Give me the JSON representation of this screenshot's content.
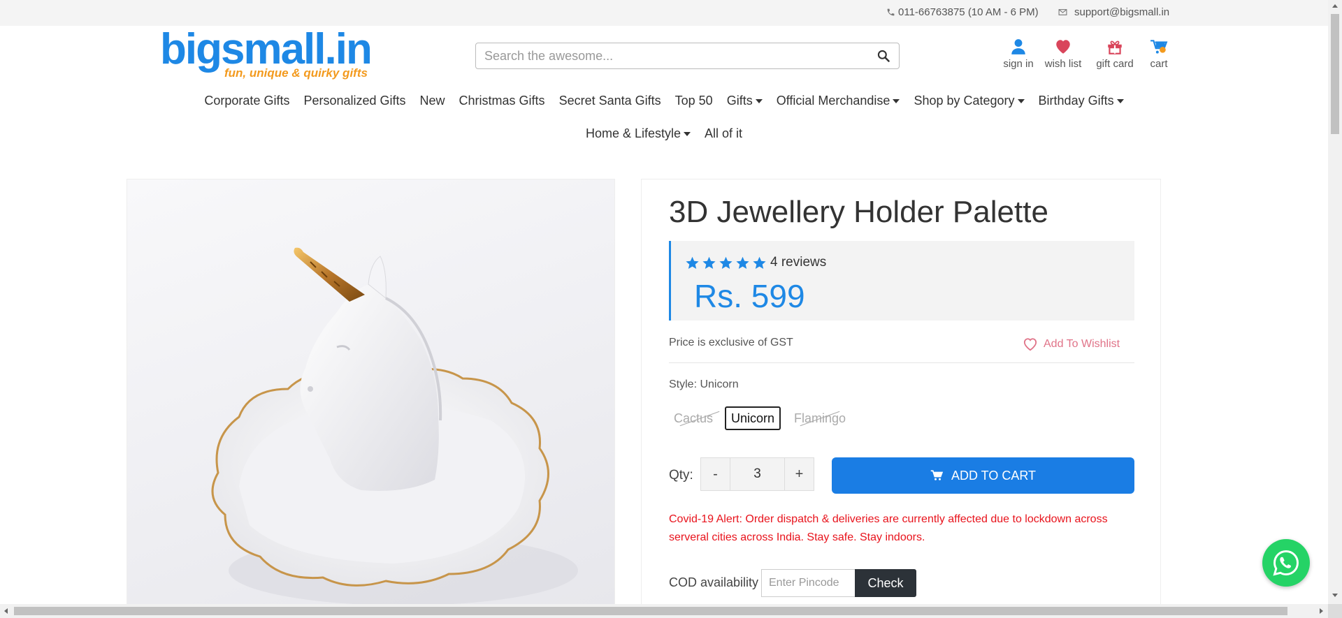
{
  "topbar": {
    "phone": "011-66763875 (10 AM - 6 PM)",
    "email": "support@bigsmall.in"
  },
  "header": {
    "logo_text": "bigsmall.in",
    "logo_tagline": "fun, unique & quirky gifts",
    "search_placeholder": "Search the awesome...",
    "icons": {
      "signin": "sign in",
      "wishlist": "wish list",
      "giftcard": "gift card",
      "cart": "cart"
    }
  },
  "nav": {
    "row1": [
      {
        "label": "Corporate Gifts",
        "dropdown": false
      },
      {
        "label": "Personalized Gifts",
        "dropdown": false
      },
      {
        "label": "New",
        "dropdown": false
      },
      {
        "label": "Christmas Gifts",
        "dropdown": false
      },
      {
        "label": "Secret Santa Gifts",
        "dropdown": false
      },
      {
        "label": "Top 50",
        "dropdown": false
      },
      {
        "label": "Gifts",
        "dropdown": true
      },
      {
        "label": "Official Merchandise",
        "dropdown": true
      },
      {
        "label": "Shop by Category",
        "dropdown": true
      },
      {
        "label": "Birthday Gifts",
        "dropdown": true
      }
    ],
    "row2": [
      {
        "label": "Home & Lifestyle",
        "dropdown": true
      },
      {
        "label": "All of it",
        "dropdown": false
      }
    ]
  },
  "product": {
    "title": "3D Jewellery Holder Palette",
    "rating_stars": 5,
    "reviews": "4 reviews",
    "price": "Rs. 599",
    "gst_note": "Price is exclusive of GST",
    "wishlist_label": "Add To Wishlist",
    "style_label": "Style: Unicorn",
    "styles": [
      {
        "label": "Cactus",
        "available": false
      },
      {
        "label": "Unicorn",
        "available": true,
        "selected": true
      },
      {
        "label": "Flamingo",
        "available": false
      }
    ],
    "qty_label": "Qty:",
    "qty_minus": "-",
    "qty_plus": "+",
    "qty_value": "3",
    "add_to_cart": "ADD TO CART",
    "covid_alert": "Covid-19 Alert: Order dispatch & deliveries are currently affected due to lockdown across serveral cities across India. Stay safe. Stay indoors.",
    "cod_label": "COD availability",
    "pincode_placeholder": "Enter Pincode",
    "check_label": "Check"
  },
  "colors": {
    "brand_blue": "#1e88e5",
    "alert_red": "#e8131c",
    "wishlist_pink": "#e07388",
    "whatsapp_green": "#25d366"
  }
}
